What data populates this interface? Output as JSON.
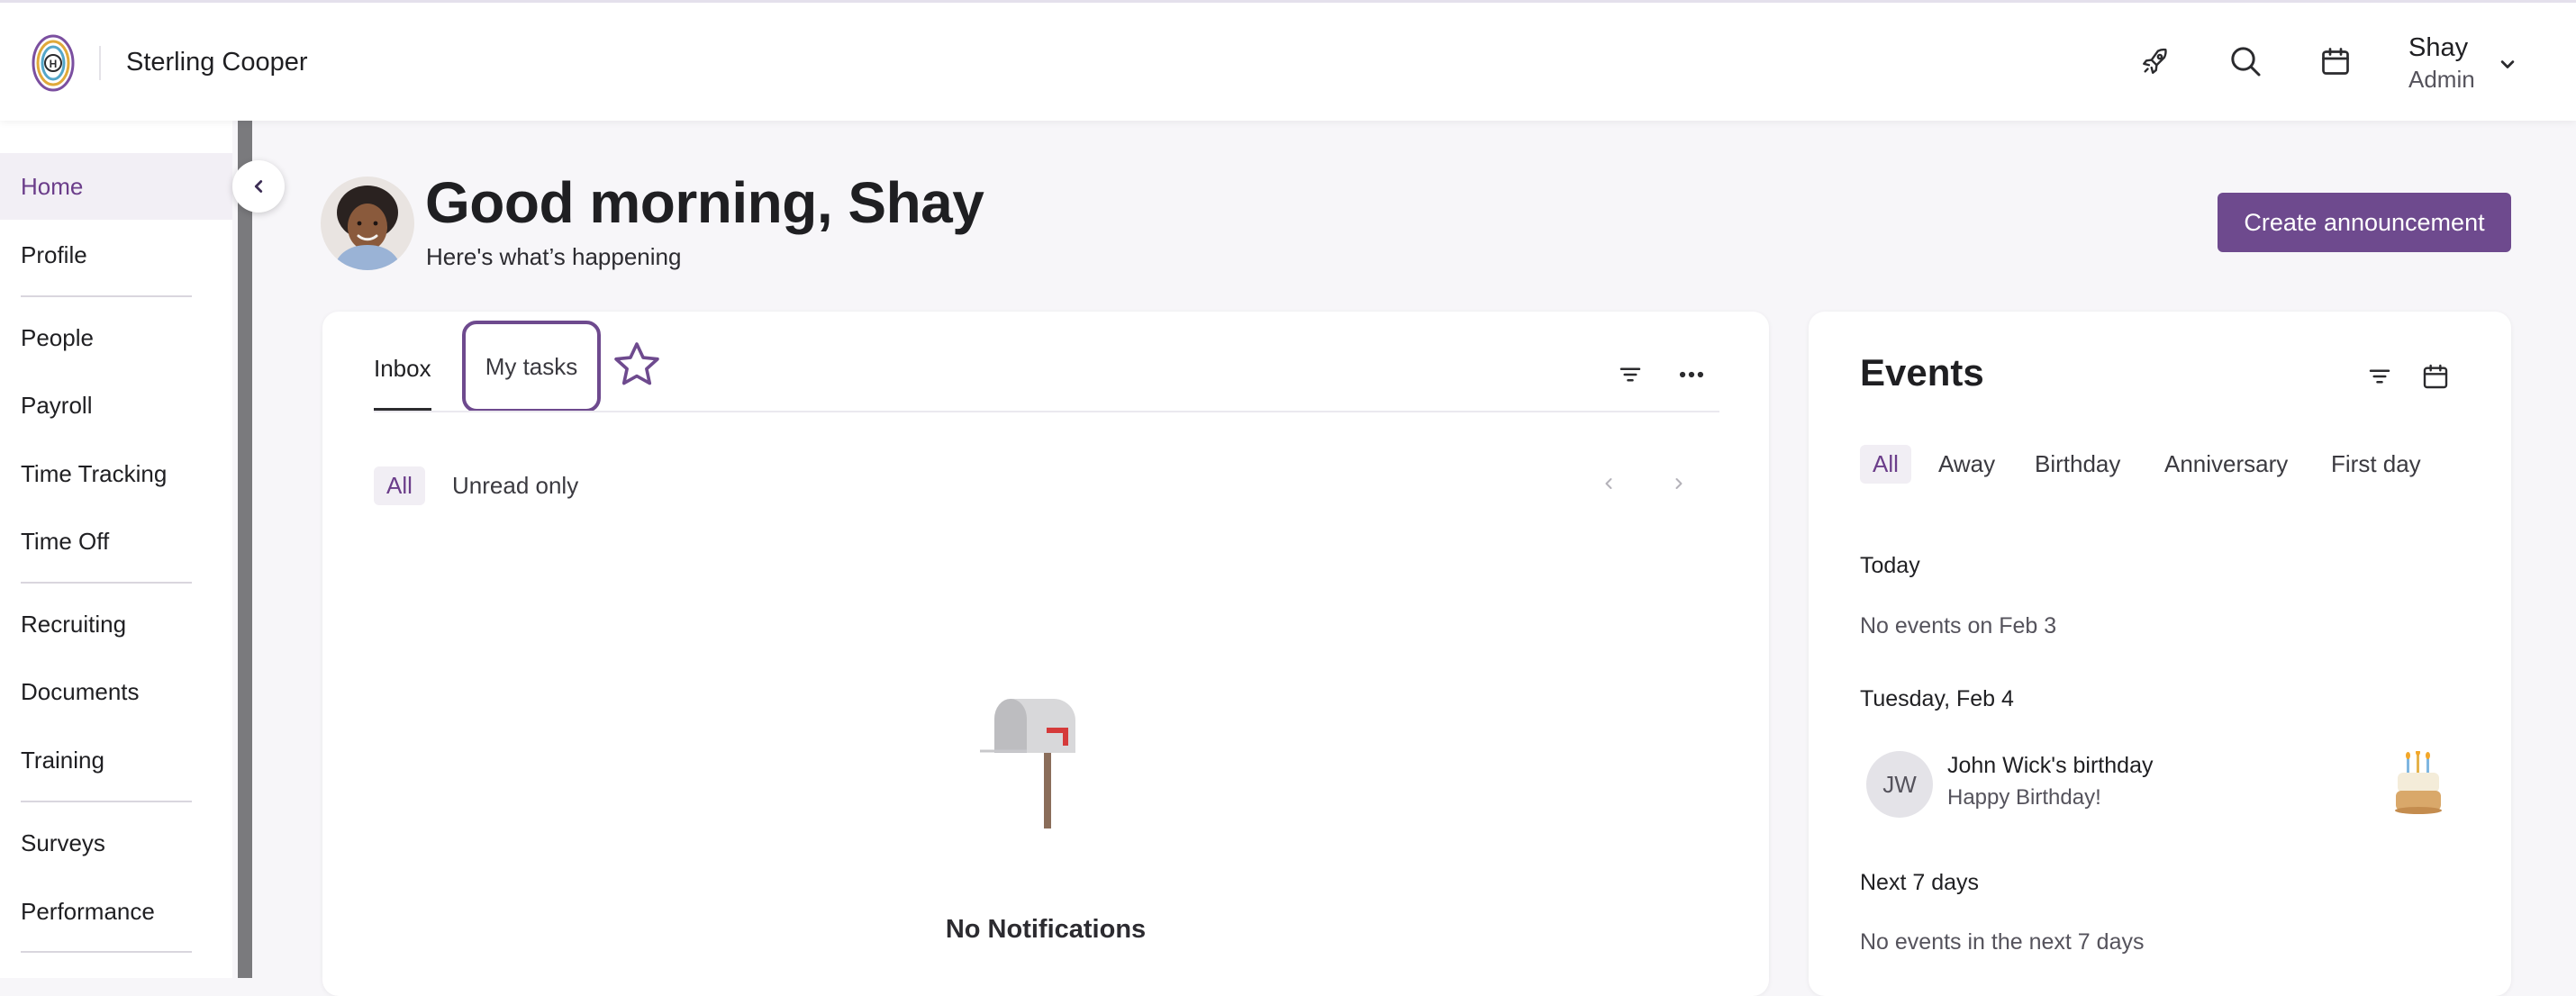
{
  "header": {
    "company": "Sterling Cooper",
    "user": {
      "name": "Shay",
      "role": "Admin"
    },
    "icons": [
      "rocket-icon",
      "search-icon",
      "calendar-icon",
      "chevron-down-icon"
    ]
  },
  "sidebar": {
    "items": [
      {
        "label": "Home",
        "active": true
      },
      {
        "label": "Profile"
      },
      {
        "label": "People"
      },
      {
        "label": "Payroll"
      },
      {
        "label": "Time Tracking"
      },
      {
        "label": "Time Off"
      },
      {
        "label": "Recruiting"
      },
      {
        "label": "Documents"
      },
      {
        "label": "Training"
      },
      {
        "label": "Surveys"
      },
      {
        "label": "Performance"
      }
    ]
  },
  "greeting": {
    "title": "Good morning, Shay",
    "subtitle": "Here's what’s happening",
    "create_button": "Create announcement"
  },
  "inbox": {
    "tabs": [
      {
        "label": "Inbox",
        "active": true
      },
      {
        "label": "My tasks",
        "focused": true
      }
    ],
    "filters": {
      "all": "All",
      "unread": "Unread only"
    },
    "empty_title": "No Notifications"
  },
  "events": {
    "title": "Events",
    "filters": [
      "All",
      "Away",
      "Birthday",
      "Anniversary",
      "First day"
    ],
    "sections": {
      "today": "Today",
      "today_empty": "No events on Feb 3",
      "tuesday": "Tuesday, Feb 4",
      "next7": "Next 7 days",
      "next7_empty": "No events in the next 7 days"
    },
    "event": {
      "initials": "JW",
      "title": "John Wick's birthday",
      "subtitle": "Happy Birthday!"
    }
  },
  "colors": {
    "accent": "#6e4a8e",
    "active_nav_bg": "#f2eff5",
    "active_text": "#6b3d8a"
  }
}
